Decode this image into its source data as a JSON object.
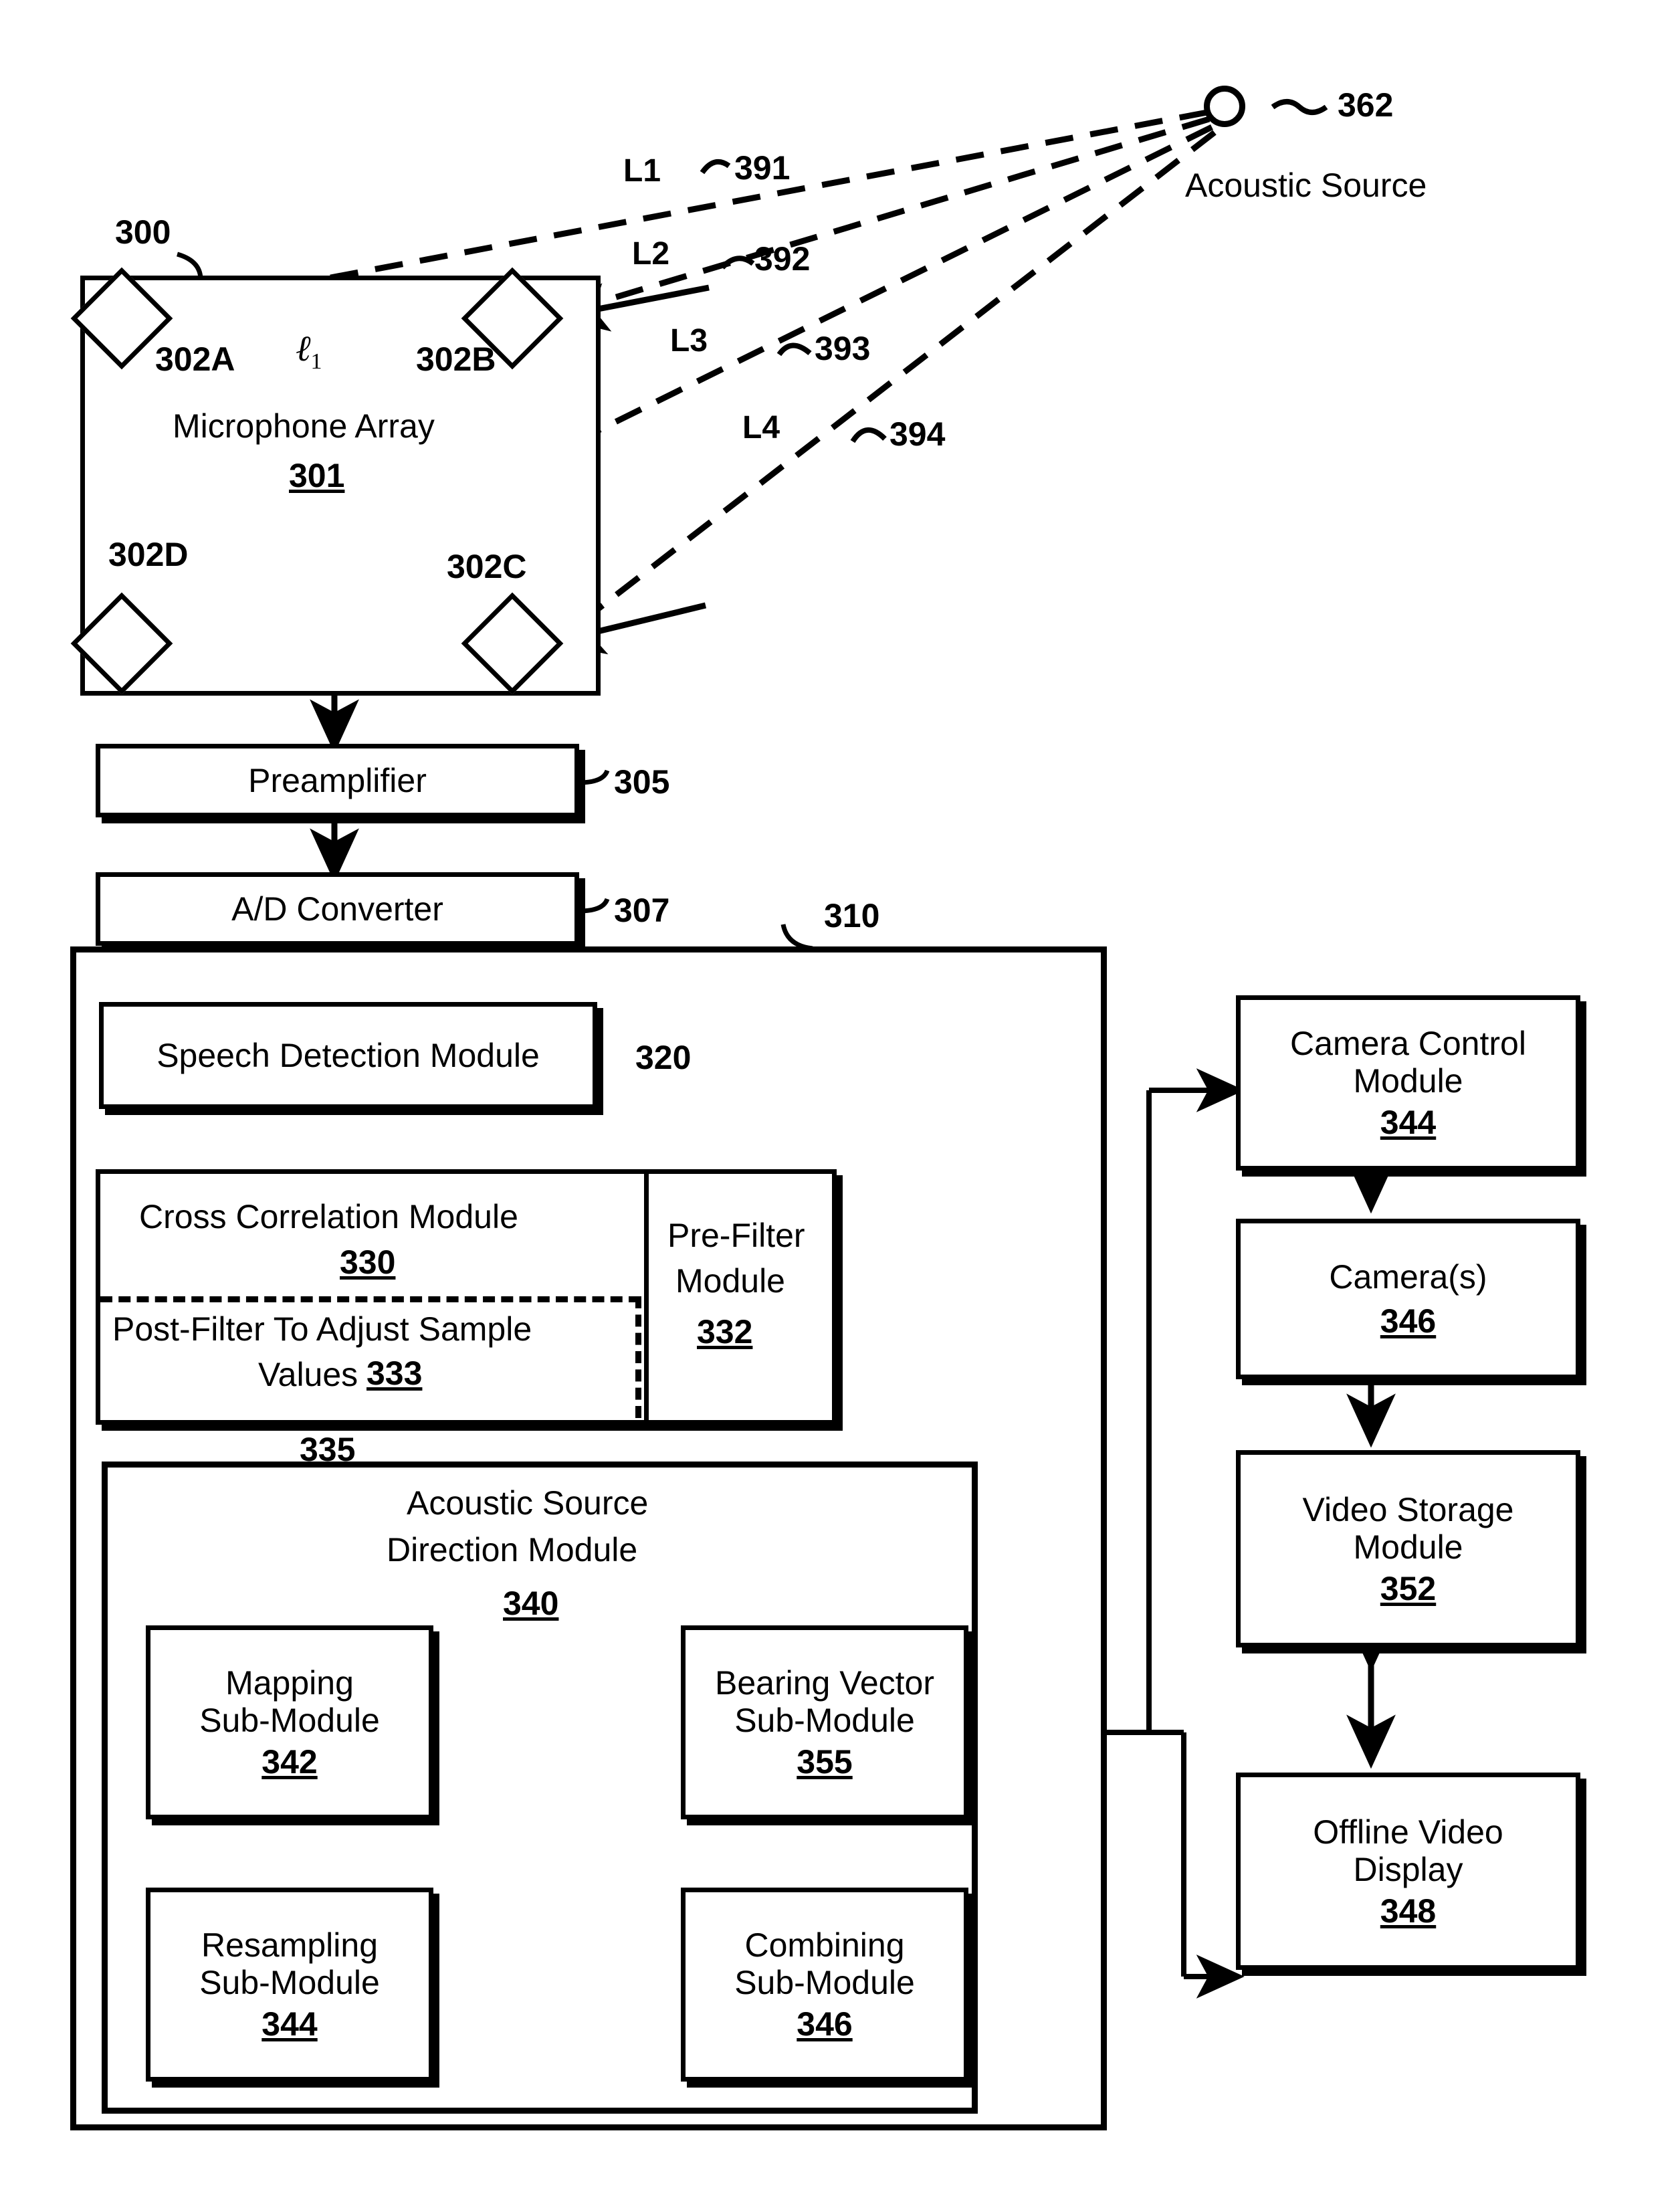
{
  "figure": {
    "title": "Acoustic source localization system block diagram",
    "ref_300": "300",
    "ref_310": "310",
    "ref_305": "305",
    "ref_307": "307",
    "ref_320": "320",
    "ref_335": "335",
    "ref_362": "362"
  },
  "source": {
    "label": "Acoustic Source",
    "ref": "362"
  },
  "paths": [
    {
      "name": "L1",
      "ref": "391"
    },
    {
      "name": "L2",
      "ref": "392"
    },
    {
      "name": "L3",
      "ref": "393"
    },
    {
      "name": "L4",
      "ref": "394"
    }
  ],
  "array": {
    "title": "Microphone Array",
    "ref": "301",
    "outer_ref": "300",
    "spacing_label": "ℓ",
    "spacing_sub": "1",
    "mics": [
      {
        "id": "302A",
        "position": "top-left"
      },
      {
        "id": "302B",
        "position": "top-right"
      },
      {
        "id": "302C",
        "position": "bottom-right"
      },
      {
        "id": "302D",
        "position": "bottom-left"
      }
    ]
  },
  "chain": {
    "preamplifier": {
      "label": "Preamplifier",
      "ref": "305"
    },
    "adc": {
      "label": "A/D Converter",
      "ref": "307"
    },
    "processor_ref": "310",
    "speech_detection": {
      "label": "Speech Detection Module",
      "ref": "320"
    },
    "cross_correlation": {
      "label": "Cross Correlation Module",
      "ref": "330"
    },
    "post_filter": {
      "label_line1": "Post-Filter To Adjust Sample",
      "label_line2": "Values",
      "ref": "333"
    },
    "pre_filter": {
      "label_line1": "Pre-Filter",
      "label_line2": "Module",
      "ref": "332"
    },
    "bus_ref": "335"
  },
  "direction_module": {
    "title_line1": "Acoustic Source",
    "title_line2": "Direction Module",
    "ref": "340",
    "submodules": [
      {
        "line1": "Mapping",
        "line2": "Sub-Module",
        "ref": "342"
      },
      {
        "line1": "Bearing Vector",
        "line2": "Sub-Module",
        "ref": "355"
      },
      {
        "line1": "Resampling",
        "line2": "Sub-Module",
        "ref": "344"
      },
      {
        "line1": "Combining",
        "line2": "Sub-Module",
        "ref": "346"
      }
    ]
  },
  "video_chain": [
    {
      "line1": "Camera Control",
      "line2": "Module",
      "ref": "344"
    },
    {
      "line1": "Camera(s)",
      "line2": "",
      "ref": "346"
    },
    {
      "line1": "Video Storage",
      "line2": "Module",
      "ref": "352"
    },
    {
      "line1": "Offline Video",
      "line2": "Display",
      "ref": "348"
    }
  ]
}
